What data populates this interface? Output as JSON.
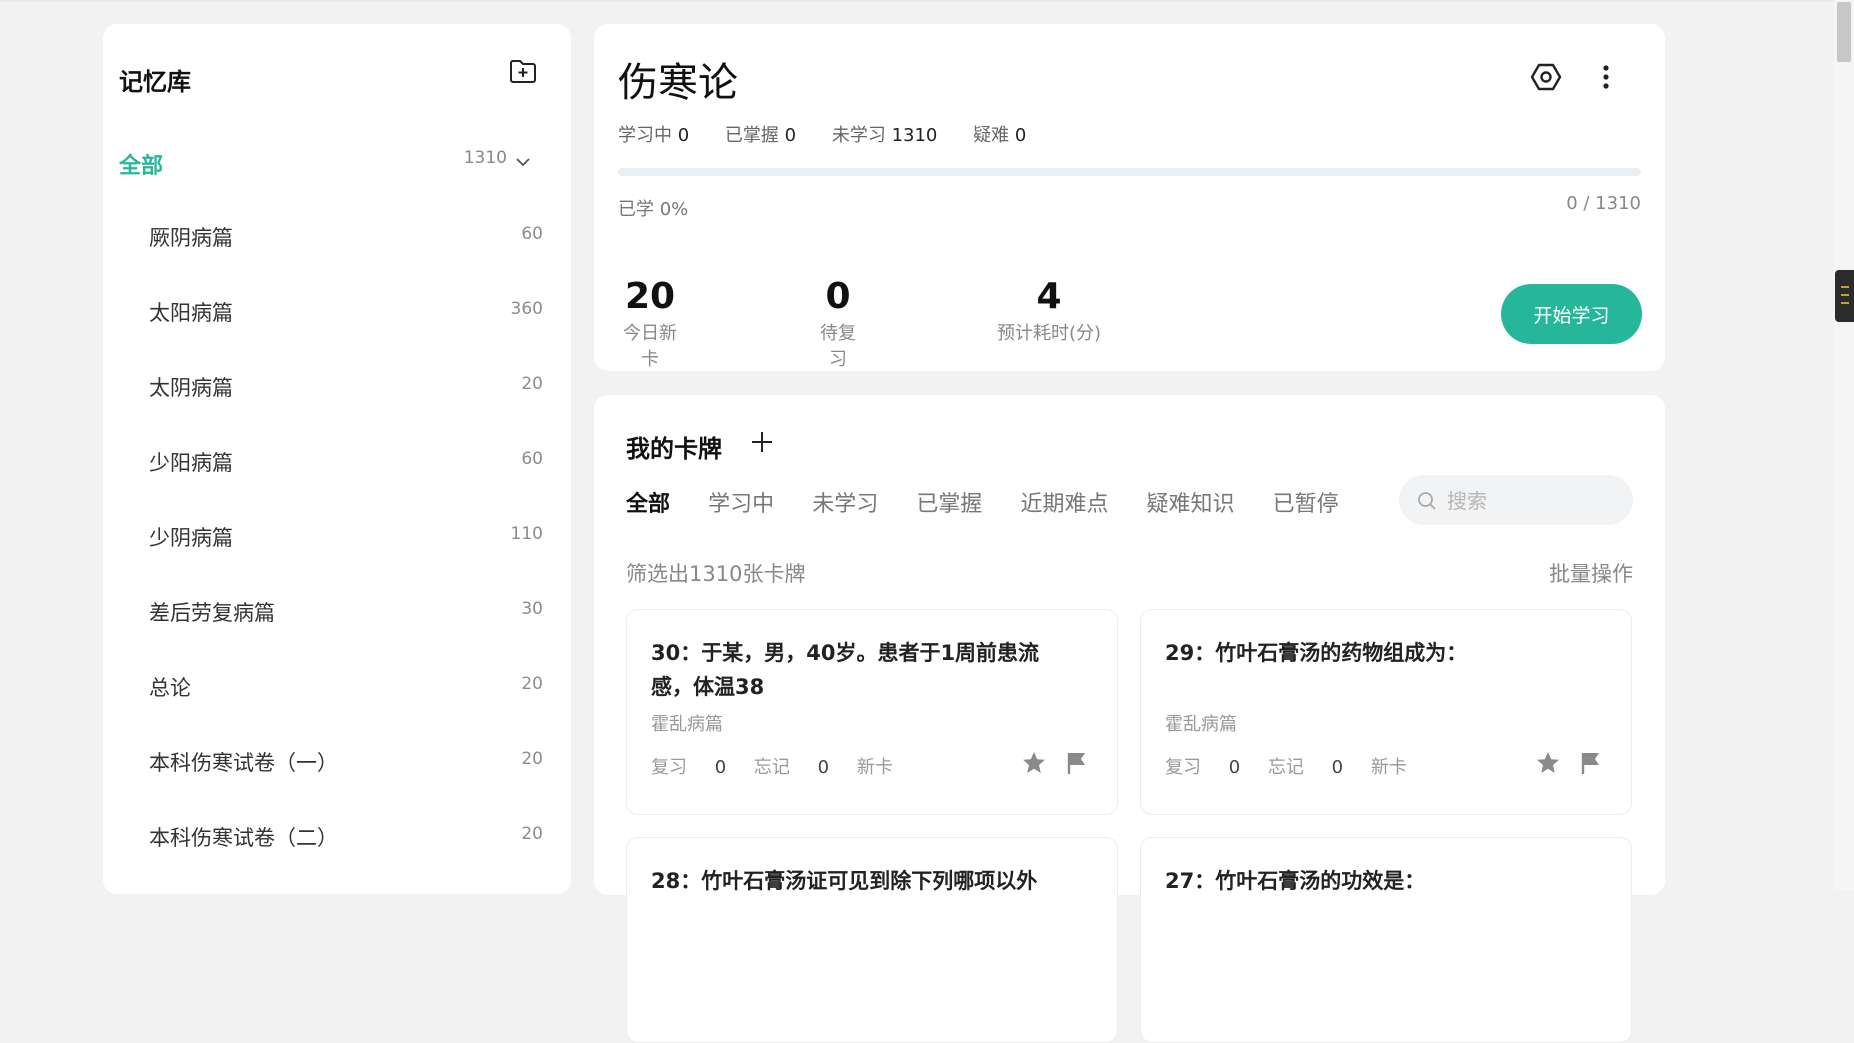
{
  "sidebar": {
    "title": "记忆库",
    "all": {
      "label": "全部",
      "count": "1310"
    },
    "items": [
      {
        "label": "厥阴病篇",
        "count": "60"
      },
      {
        "label": "太阳病篇",
        "count": "360"
      },
      {
        "label": "太阴病篇",
        "count": "20"
      },
      {
        "label": "少阳病篇",
        "count": "60"
      },
      {
        "label": "少阴病篇",
        "count": "110"
      },
      {
        "label": "差后劳复病篇",
        "count": "30"
      },
      {
        "label": "总论",
        "count": "20"
      },
      {
        "label": "本科伤寒试卷（一）",
        "count": "20"
      },
      {
        "label": "本科伤寒试卷（二）",
        "count": "20"
      }
    ]
  },
  "deck": {
    "title": "伤寒论",
    "stats": [
      {
        "label": "学习中",
        "value": "0"
      },
      {
        "label": "已掌握",
        "value": "0"
      },
      {
        "label": "未学习",
        "value": "1310"
      },
      {
        "label": "疑难",
        "value": "0"
      }
    ],
    "progress_percent": 0,
    "progress_label": "已学 0%",
    "progress_count": "0 / 1310",
    "metrics": [
      {
        "value": "20",
        "label": "今日新卡"
      },
      {
        "value": "0",
        "label": "待复习"
      },
      {
        "value": "4",
        "label": "预计耗时(分)"
      }
    ],
    "start_button": "开始学习",
    "accent_color": "#26b79b"
  },
  "cards_panel": {
    "title": "我的卡牌",
    "tabs": [
      "全部",
      "学习中",
      "未学习",
      "已掌握",
      "近期难点",
      "疑难知识",
      "已暂停"
    ],
    "active_tab": "全部",
    "search_placeholder": "搜索",
    "filter_count": "筛选出1310张卡牌",
    "batch_op": "批量操作",
    "cards": [
      {
        "title": "30：于某，男，40岁。患者于1周前患流感，体温38",
        "chapter": "霍乱病篇",
        "review_label": "复习",
        "review": "0",
        "forget_label": "忘记",
        "forget": "0",
        "status": "新卡"
      },
      {
        "title": "29：竹叶石膏汤的药物组成为：",
        "chapter": "霍乱病篇",
        "review_label": "复习",
        "review": "0",
        "forget_label": "忘记",
        "forget": "0",
        "status": "新卡"
      },
      {
        "title": "28：竹叶石膏汤证可见到除下列哪项以外"
      },
      {
        "title": "27：竹叶石膏汤的功效是："
      }
    ]
  },
  "icons": {
    "add_folder": "folder-plus-icon",
    "chevron": "chevron-down-icon",
    "settings": "settings-hexagon-icon",
    "more": "more-vertical-icon",
    "add": "plus-icon",
    "search": "search-icon",
    "star": "star-icon",
    "flag": "flag-icon"
  }
}
